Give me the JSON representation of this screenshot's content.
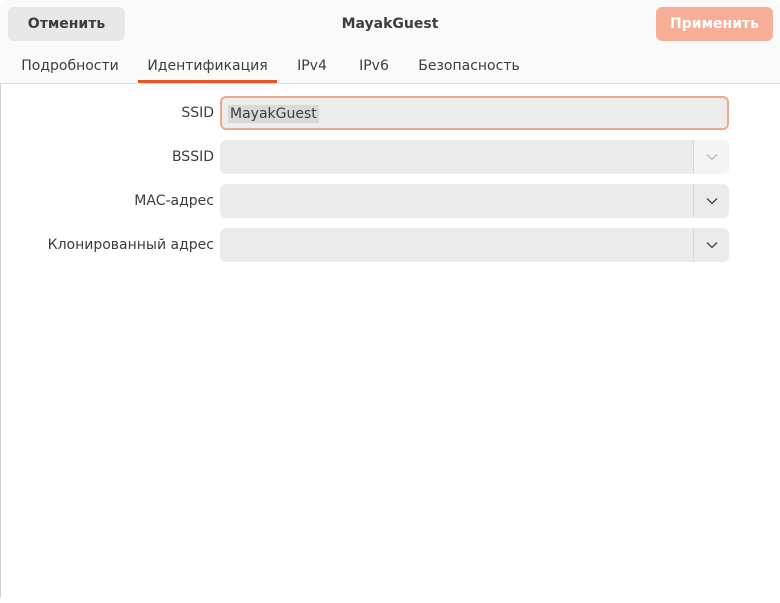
{
  "header": {
    "cancel_label": "Отменить",
    "title": "MayakGuest",
    "apply_label": "Применить"
  },
  "tabs": [
    {
      "label": "Подробности",
      "active": false
    },
    {
      "label": "Идентификация",
      "active": true
    },
    {
      "label": "IPv4",
      "active": false
    },
    {
      "label": "IPv6",
      "active": false
    },
    {
      "label": "Безопасность",
      "active": false
    }
  ],
  "form": {
    "ssid": {
      "label": "SSID",
      "value": "MayakGuest"
    },
    "bssid": {
      "label": "BSSID",
      "value": ""
    },
    "mac": {
      "label": "MAC-адрес",
      "value": ""
    },
    "cloned": {
      "label": "Клонированный адрес",
      "value": ""
    }
  },
  "colors": {
    "accent": "#e95420",
    "apply_button": "#f6ae98",
    "focus_border": "#f0a58d"
  },
  "icons": {
    "dropdown": "chevron-down-icon"
  }
}
